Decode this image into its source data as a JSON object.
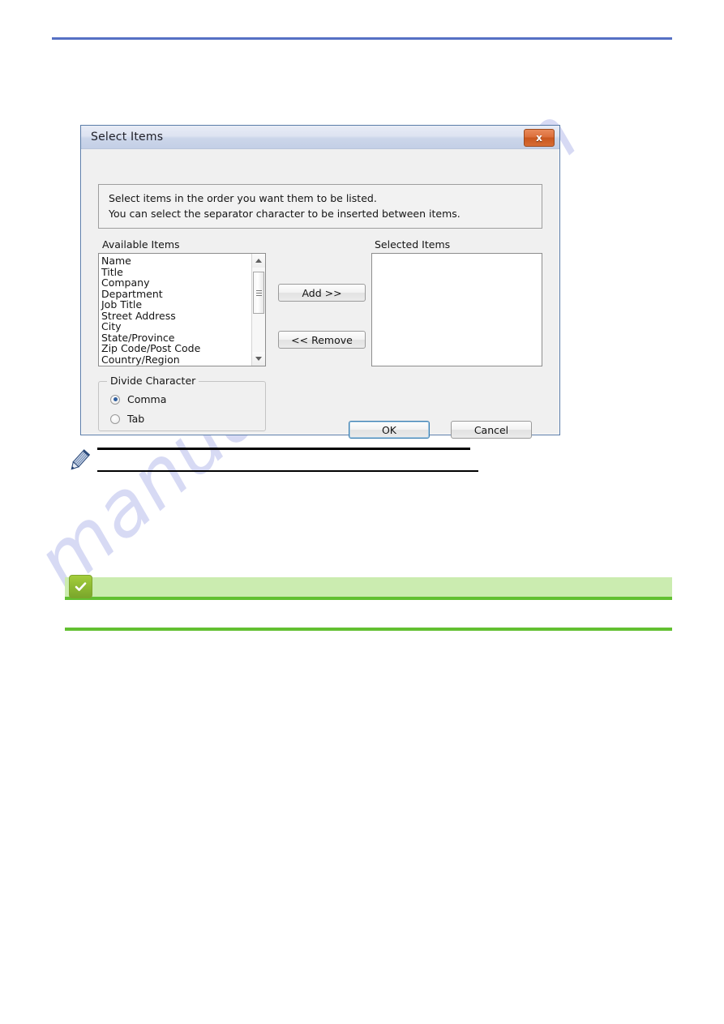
{
  "page": {
    "top_rule_color": "#5570c4",
    "watermark_text": "manualshive.com",
    "watermark_color": "#c9cdf0"
  },
  "dialog": {
    "title": "Select Items",
    "close_label": "x",
    "info": {
      "line1": "Select items in the order you want them to be listed.",
      "line2": "You can select the separator character to be inserted between items."
    },
    "available": {
      "label": "Available Items",
      "items": [
        "Name",
        "Title",
        "Company",
        "Department",
        "Job Title",
        "Street Address",
        "City",
        "State/Province",
        "Zip Code/Post Code",
        "Country/Region"
      ]
    },
    "selected": {
      "label": "Selected Items",
      "items": []
    },
    "transfer_buttons": {
      "add": "Add >>",
      "remove": "<< Remove"
    },
    "divide_character": {
      "legend": "Divide Character",
      "options": [
        {
          "label": "Comma",
          "checked": true
        },
        {
          "label": "Tab",
          "checked": false
        }
      ]
    },
    "actions": {
      "ok": "OK",
      "cancel": "Cancel"
    }
  },
  "note": {
    "icon": "pencil-icon"
  },
  "tip": {
    "icon": "check-badge-icon",
    "banner_color": "#cbecb0",
    "rule_color": "#62c031"
  }
}
